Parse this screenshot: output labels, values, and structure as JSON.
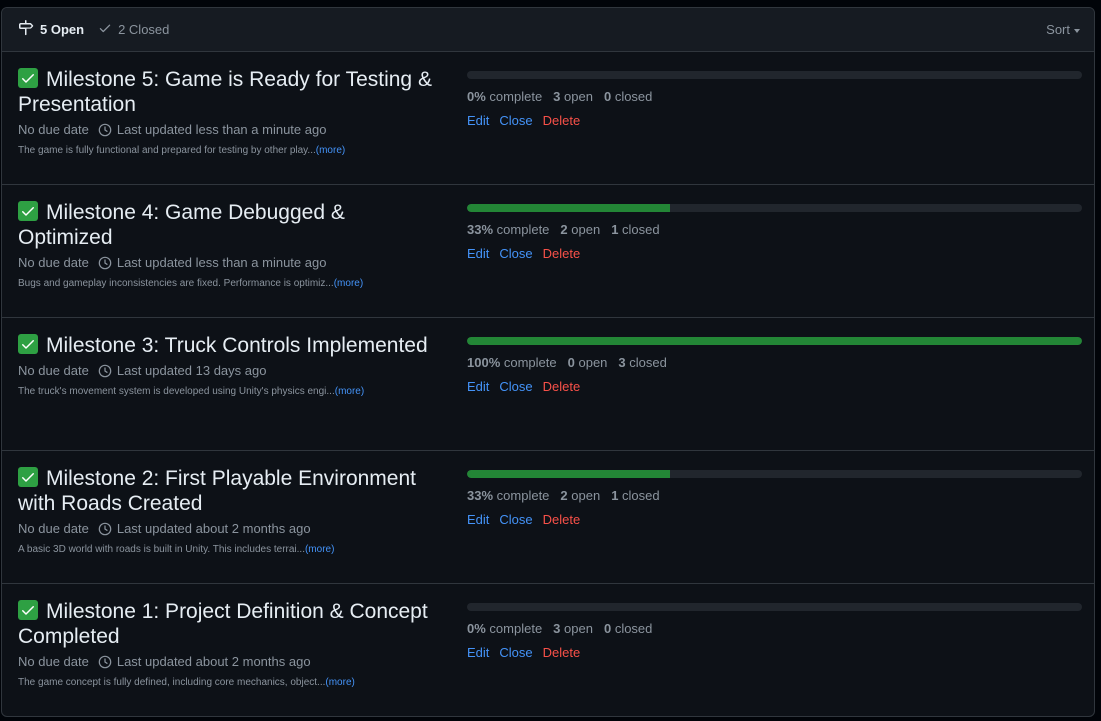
{
  "header": {
    "open_label": "5 Open",
    "closed_label": "2 Closed",
    "sort_label": "Sort"
  },
  "colors": {
    "progress_fill": "#238636",
    "progress_track": "#21262d",
    "check_bg": "#2ea043",
    "link": "#4493f8",
    "danger": "#f85149"
  },
  "milestones": [
    {
      "title": "Milestone 5: Game is Ready for Testing & Presentation",
      "due": "No due date",
      "updated": "Last updated less than a minute ago",
      "description": "The game is fully functional and prepared for testing by other play...",
      "more": "(more)",
      "progress": 0,
      "complete_pct": "0%",
      "complete_word": "complete",
      "open_count": "3",
      "open_word": "open",
      "closed_count": "0",
      "closed_word": "closed",
      "edit": "Edit",
      "close": "Close",
      "delete": "Delete"
    },
    {
      "title": "Milestone 4: Game Debugged & Optimized",
      "due": "No due date",
      "updated": "Last updated less than a minute ago",
      "description": "Bugs and gameplay inconsistencies are fixed. Performance is optimiz...",
      "more": "(more)",
      "progress": 0.33,
      "complete_pct": "33%",
      "complete_word": "complete",
      "open_count": "2",
      "open_word": "open",
      "closed_count": "1",
      "closed_word": "closed",
      "edit": "Edit",
      "close": "Close",
      "delete": "Delete"
    },
    {
      "title": "Milestone 3: Truck Controls Implemented",
      "due": "No due date",
      "updated": "Last updated 13 days ago",
      "description": "The truck's movement system is developed using Unity's physics engi...",
      "more": "(more)",
      "progress": 1,
      "complete_pct": "100%",
      "complete_word": "complete",
      "open_count": "0",
      "open_word": "open",
      "closed_count": "3",
      "closed_word": "closed",
      "edit": "Edit",
      "close": "Close",
      "delete": "Delete"
    },
    {
      "title": "Milestone 2: First Playable Environment with Roads Created",
      "due": "No due date",
      "updated": "Last updated about 2 months ago",
      "description": "A basic 3D world with roads is built in Unity. This includes terrai...",
      "more": "(more)",
      "progress": 0.33,
      "complete_pct": "33%",
      "complete_word": "complete",
      "open_count": "2",
      "open_word": "open",
      "closed_count": "1",
      "closed_word": "closed",
      "edit": "Edit",
      "close": "Close",
      "delete": "Delete"
    },
    {
      "title": "Milestone 1: Project Definition & Concept Completed",
      "due": "No due date",
      "updated": "Last updated about 2 months ago",
      "description": "The game concept is fully defined, including core mechanics, object...",
      "more": "(more)",
      "progress": 0,
      "complete_pct": "0%",
      "complete_word": "complete",
      "open_count": "3",
      "open_word": "open",
      "closed_count": "0",
      "closed_word": "closed",
      "edit": "Edit",
      "close": "Close",
      "delete": "Delete"
    }
  ]
}
